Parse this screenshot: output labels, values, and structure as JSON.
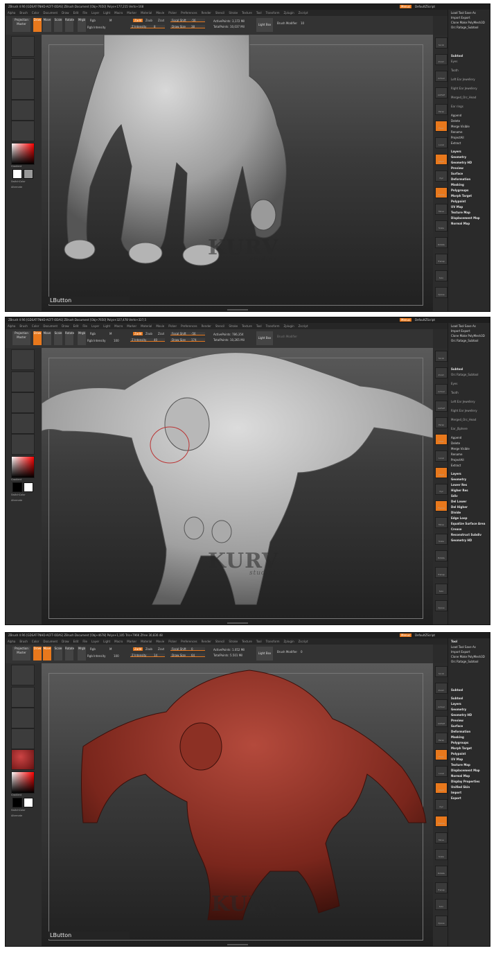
{
  "panels": [
    {
      "id": "hand",
      "title": "ZBrush 4 R6 [GDSAT-TNHD-ACFT-ODAS]  ZBrush Document  [Obj+7650] Polys+177,215 Verts+168",
      "menus": [
        "Alpha",
        "Brush",
        "Color",
        "Document",
        "Draw",
        "Edit",
        "File",
        "Layer",
        "Light",
        "Macro",
        "Marker",
        "Material",
        "Movie",
        "Picker",
        "Preferences",
        "Render",
        "Stencil",
        "Stroke",
        "Texture",
        "Tool",
        "Transform",
        "Zplugin",
        "Zscript"
      ],
      "toolbar": {
        "projection_master": "Projection Master",
        "draw": "Draw",
        "move": "Move",
        "scale": "Scale",
        "rotate": "Rotate",
        "mrgb": "Mrgb",
        "rgb": "Rgb",
        "m": "M",
        "rgb_intensity": "Rgb Intensity",
        "zadd": "Zadd",
        "zsub": "Zsub",
        "zcut": "Zcut",
        "z_intensity": "Z Intensity",
        "z_intensity_value": "8",
        "focal_shift": "Focal Shift",
        "focal_shift_value": "-56",
        "draw_size": "Draw Size",
        "draw_size_value": "38",
        "active_points": "ActivePoints: 3,172 Mil",
        "total_points": "TotalPoints: 10,037 Mil",
        "light_box": "Light Box",
        "brush_modifier": "Brush Modifier",
        "brush_modifier_value": "10"
      },
      "left_tray": {
        "gradient": "Gradient",
        "switch_color": "SwitchColor",
        "alternate": "Alternate"
      },
      "right_panel": {
        "header": [
          "Load Tool",
          "Save As",
          "Import",
          "Export",
          "Clone",
          "Make PolyMesh3D",
          "Orc Ratage_Subtool"
        ],
        "subtool_label": "Subtool",
        "subtool_items": [
          "Eyes",
          "Tooth",
          "Left Ear Jewellery",
          "Right Ear Jewellery",
          "Merged_Orc_Head",
          "Ear rings"
        ],
        "actions": [
          "Append",
          "Delete",
          "Merge Visible",
          "Rename",
          "ProjectAll",
          "Extract"
        ],
        "menu": [
          "Layers",
          "Geometry",
          "Geometry HD",
          "Preview",
          "Surface",
          "Deformation",
          "Masking",
          "Polygroups",
          "Morph Target",
          "Polypaint",
          "UV Map",
          "Texture Map",
          "Displacement Map",
          "Normal Map"
        ]
      },
      "lbutton": "LButton",
      "watermark": "KURV",
      "watermark_sub": "studios"
    },
    {
      "id": "orc-gray",
      "title": "ZBrush 4 R6 [GDSAT-TNHD-ACFT-ODAS]  ZBrush Document  [Obj+7650] Polys+327,478 Verts+327,5",
      "menus": [
        "Alpha",
        "Brush",
        "Color",
        "Document",
        "Draw",
        "Edit",
        "File",
        "Layer",
        "Light",
        "Macro",
        "Marker",
        "Material",
        "Movie",
        "Picker",
        "Preferences",
        "Render",
        "Stencil",
        "Stroke",
        "Texture",
        "Tool",
        "Transform",
        "Zplugin",
        "Zscript"
      ],
      "toolbar": {
        "projection_master": "Projection Master",
        "draw": "Draw",
        "move": "Move",
        "scale": "Scale",
        "rotate": "Rotate",
        "mrgb": "Mrgb",
        "rgb": "Rgb",
        "m": "M",
        "rgb_intensity": "Rgb Intensity",
        "rgb_intensity_value": "100",
        "zadd": "Zadd",
        "zsub": "Zsub",
        "zcut": "Zcut",
        "z_intensity": "Z Intensity",
        "z_intensity_value": "40",
        "focal_shift": "Focal Shift",
        "focal_shift_value": "-56",
        "draw_size": "Draw Size",
        "draw_size_value": "174",
        "active_points": "ActivePoints: 786,354",
        "total_points": "TotalPoints: 10,265 Mil",
        "light_box": "Light Box",
        "brush_modifier": "Brush Modifier",
        "brush_modifier_value": "0"
      },
      "left_tray": {
        "gradient": "Gradient",
        "switch_color": "SwitchColor",
        "alternate": "Alternate"
      },
      "right_panel": {
        "header": [
          "Load Tool",
          "Save As",
          "Import",
          "Export",
          "Clone",
          "Make PolyMesh3D",
          "Orc Ratage_Subtool"
        ],
        "subtool_label": "Subtool",
        "subtool_items": [
          "Orc Ratage_Subtool",
          "Eyes",
          "Tooth",
          "Left Ear Jewellery",
          "Right Ear Jewellery",
          "Merged_Orc_Head",
          "Ear_JSphere"
        ],
        "actions": [
          "Append",
          "Delete",
          "Merge Visible",
          "Rename",
          "ProjectAll",
          "Extract"
        ],
        "menu": [
          "Layers",
          "Geometry",
          "Lower Res",
          "Higher Res",
          "Sdiv",
          "Del Lower",
          "Del Higher",
          "Divide",
          "Edge Loop",
          "Equalize Surface Area",
          "Crease",
          "Reconstruct Subdiv",
          "Geometry HD"
        ]
      },
      "lbutton": "",
      "watermark": "KURV",
      "watermark_sub": "studios"
    },
    {
      "id": "orc-red",
      "title": "ZBrush 4 R6 [GDSAT-TNHD-ACFT-ODAS]  ZBrush Document  [Obj+4678] Polys+1,105 Tris+796K Zfree 30,830.48",
      "menus": [
        "Alpha",
        "Brush",
        "Color",
        "Document",
        "Draw",
        "Edit",
        "File",
        "Layer",
        "Light",
        "Macro",
        "Marker",
        "Material",
        "Movie",
        "Picker",
        "Preferences",
        "Render",
        "Stencil",
        "Stroke",
        "Texture",
        "Tool",
        "Transform",
        "Zplugin",
        "Zscript"
      ],
      "toolbar": {
        "projection_master": "Projection Master",
        "draw": "Draw",
        "move": "Move",
        "scale": "Scale",
        "rotate": "Rotate",
        "mrgb": "Mrgb",
        "rgb": "Rgb",
        "m": "M",
        "rgb_intensity": "Rgb Intensity",
        "rgb_intensity_value": "100",
        "zadd": "Zadd",
        "zsub": "Zsub",
        "zcut": "Zcut",
        "z_intensity": "Z Intensity",
        "z_intensity_value": "14",
        "focal_shift": "Focal Shift",
        "focal_shift_value": "0",
        "draw_size": "Draw Size",
        "draw_size_value": "64",
        "active_points": "ActivePoints: 1.052 Mil",
        "total_points": "TotalPoints: 5.501 Mil",
        "light_box": "Light Box",
        "brush_modifier": "Brush Modifier",
        "brush_modifier_value": "0"
      },
      "left_tray": {
        "gradient": "Gradient",
        "switch_color": "SwitchColor",
        "alternate": "Alternate"
      },
      "right_panel": {
        "tool_label": "Tool",
        "header": [
          "Load Tool",
          "Save As",
          "Import",
          "Export",
          "Clone",
          "Make PolyMesh3D",
          "Orc Ratage_Subtool"
        ],
        "subtool_label": "Subtool",
        "subtool_items": [],
        "actions": [],
        "menu": [
          "Subtool",
          "Layers",
          "Geometry",
          "Geometry HD",
          "Preview",
          "Surface",
          "Deformation",
          "Masking",
          "Polygroups",
          "Morph Target",
          "Polypaint",
          "UV Map",
          "Texture Map",
          "Displacement Map",
          "Normal Map",
          "Display Properties",
          "Unified Skin",
          "Import",
          "Export"
        ]
      },
      "lbutton": "LButton",
      "watermark": "KURV",
      "watermark_sub": "studios"
    }
  ],
  "ui_labels": {
    "default_zscript": "DefaultZScript",
    "menus_toggle": "Menus",
    "right_tools": [
      "Scroll",
      "Zoom",
      "Actual",
      "AAHalf",
      "Persp",
      "Floor",
      "Local",
      "LSym",
      "Xyz",
      "Frame",
      "Move",
      "Scale",
      "Rotate",
      "Transp",
      "Solo",
      "Xpose"
    ]
  },
  "colors": {
    "accent": "#e8781c",
    "ui_bg": "#2b2b2b",
    "hand_material": "#bdbdbd",
    "orc_gray_material": "#c8c8c8",
    "orc_red_material": "#8a2e22"
  }
}
